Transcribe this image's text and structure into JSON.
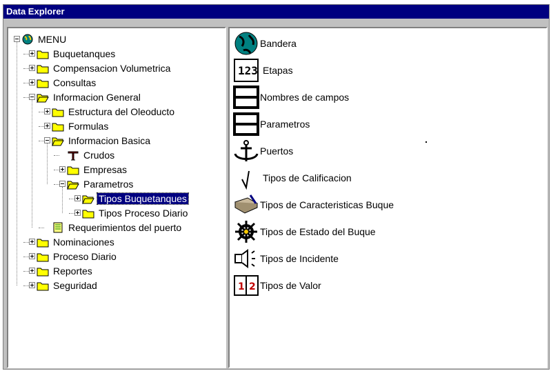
{
  "window": {
    "title": "Data Explorer"
  },
  "tree": {
    "nodes": [
      {
        "label": "MENU",
        "icon": "globe-icon",
        "expander": "minus"
      },
      {
        "label": "Buquetanques",
        "icon": "folder-icon",
        "expander": "plus"
      },
      {
        "label": "Compensacion Volumetrica",
        "icon": "folder-icon",
        "expander": "plus"
      },
      {
        "label": "Consultas",
        "icon": "folder-icon",
        "expander": "plus"
      },
      {
        "label": "Informacion General",
        "icon": "folder-open-icon",
        "expander": "minus"
      },
      {
        "label": "Estructura del Oleoducto",
        "icon": "folder-icon",
        "expander": "plus"
      },
      {
        "label": "Formulas",
        "icon": "folder-icon",
        "expander": "plus"
      },
      {
        "label": "Informacion Basica",
        "icon": "folder-open-icon",
        "expander": "minus"
      },
      {
        "label": "Crudos",
        "icon": "oil-derrick-icon",
        "expander": "none"
      },
      {
        "label": "Empresas",
        "icon": "folder-icon",
        "expander": "plus"
      },
      {
        "label": "Parametros",
        "icon": "folder-open-icon",
        "expander": "minus"
      },
      {
        "label": "Tipos Buquetanques",
        "icon": "folder-open-icon",
        "expander": "plus",
        "selected": true
      },
      {
        "label": "Tipos Proceso Diario",
        "icon": "folder-icon",
        "expander": "plus"
      },
      {
        "label": "Requerimientos del puerto",
        "icon": "document-icon",
        "expander": "none"
      },
      {
        "label": "Nominaciones",
        "icon": "folder-icon",
        "expander": "plus"
      },
      {
        "label": "Proceso Diario",
        "icon": "folder-icon",
        "expander": "plus"
      },
      {
        "label": "Reportes",
        "icon": "folder-icon",
        "expander": "plus"
      },
      {
        "label": "Seguridad",
        "icon": "folder-icon",
        "expander": "plus"
      }
    ]
  },
  "list": {
    "items": [
      {
        "label": "Bandera",
        "icon": "globe-icon"
      },
      {
        "label": "Etapas",
        "icon": "numbers-123-icon"
      },
      {
        "label": "Nombres de campos",
        "icon": "table-icon"
      },
      {
        "label": "Parametros",
        "icon": "table-icon"
      },
      {
        "label": "Puertos",
        "icon": "anchor-icon"
      },
      {
        "label": "Tipos de Calificacion",
        "icon": "checkmark-icon"
      },
      {
        "label": "Tipos de Caracteristicas Buque",
        "icon": "book-pen-icon"
      },
      {
        "label": "Tipos de Estado del Buque",
        "icon": "ship-wheel-icon"
      },
      {
        "label": "Tipos de Incidente",
        "icon": "speaker-icon"
      },
      {
        "label": "Tipos de Valor",
        "icon": "book-12-icon"
      }
    ]
  },
  "colors": {
    "titlebar": "#000080",
    "selection": "#000080",
    "folder": "#ffff00",
    "window": "#c0c0c0"
  }
}
